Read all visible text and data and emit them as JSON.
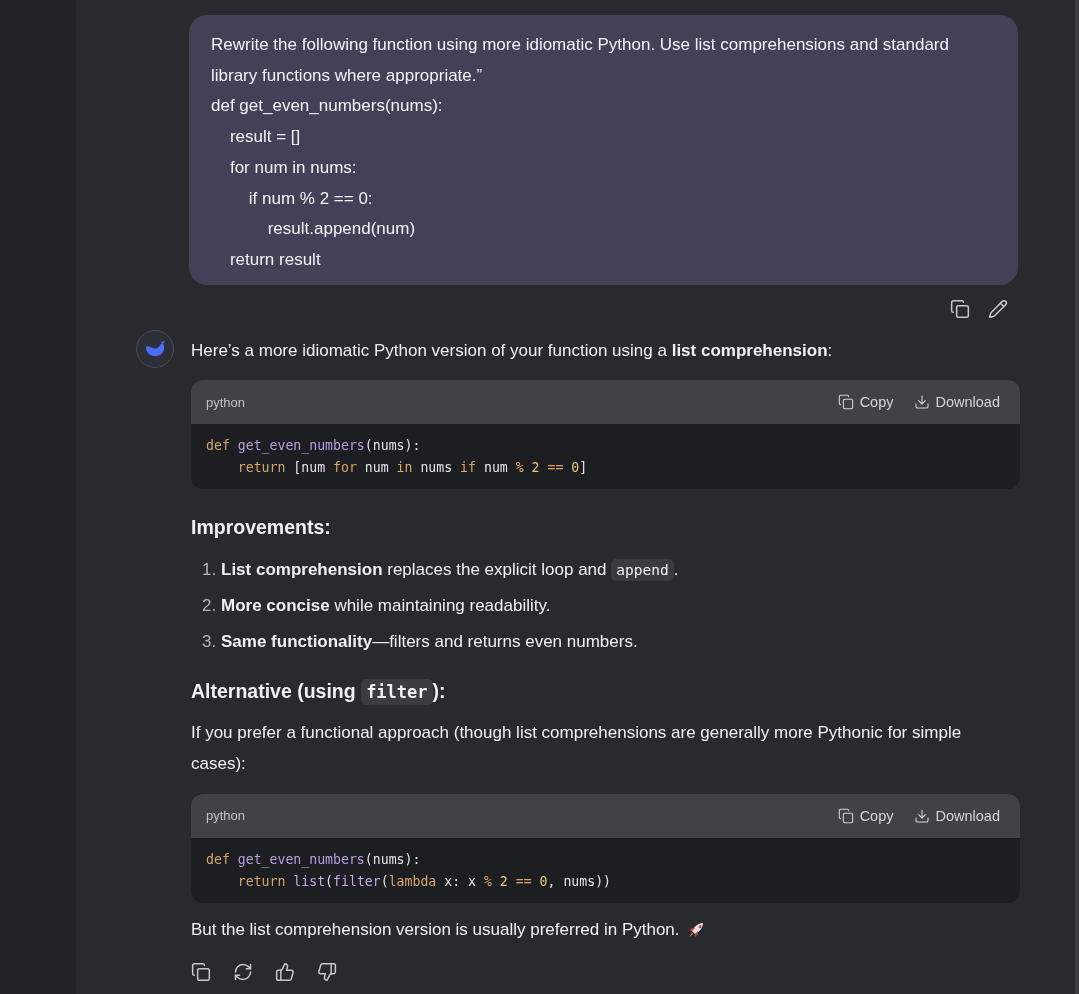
{
  "user_message": {
    "lines": [
      "Rewrite the following function using more idiomatic Python. Use list comprehensions and standard library functions where appropriate.”",
      "def get_even_numbers(nums):",
      "    result = []",
      "    for num in nums:",
      "        if num % 2 == 0:",
      "            result.append(num)",
      "    return result"
    ]
  },
  "answer": {
    "intro": "Here’s a more idiomatic Python version of your function using a **list comprehension**:",
    "blocks": [
      {
        "kind": "code",
        "language": "python",
        "copy_label": "Copy",
        "download_label": "Download",
        "lines": [
          [
            {
              "text": "def ",
              "kind": "keyword"
            },
            {
              "text": "get_even_numbers",
              "kind": "function"
            },
            {
              "text": "(nums):",
              "kind": "plain"
            }
          ],
          [
            {
              "text": "    return",
              "kind": "keyword"
            },
            {
              "text": " [num ",
              "kind": "plain"
            },
            {
              "text": "for",
              "kind": "keyword"
            },
            {
              "text": " num ",
              "kind": "plain"
            },
            {
              "text": "in",
              "kind": "keyword"
            },
            {
              "text": " nums ",
              "kind": "plain"
            },
            {
              "text": "if",
              "kind": "keyword"
            },
            {
              "text": " num ",
              "kind": "plain"
            },
            {
              "text": "% ",
              "kind": "operator"
            },
            {
              "text": "2 ",
              "kind": "number"
            },
            {
              "text": "== ",
              "kind": "operator"
            },
            {
              "text": "0",
              "kind": "number"
            },
            {
              "text": "]",
              "kind": "plain"
            }
          ]
        ]
      },
      {
        "kind": "heading",
        "parts": [
          {
            "text": "Improvements:",
            "kind": "text"
          }
        ]
      },
      {
        "kind": "list",
        "items": [
          {
            "number": "1.",
            "parts": [
              {
                "text": "List comprehension",
                "kind": "bold"
              },
              {
                "text": " replaces the explicit loop and ",
                "kind": "text"
              },
              {
                "text": "append",
                "kind": "code"
              },
              {
                "text": ".",
                "kind": "text"
              }
            ]
          },
          {
            "number": "2.",
            "parts": [
              {
                "text": "More concise",
                "kind": "bold"
              },
              {
                "text": " while maintaining readability.",
                "kind": "text"
              }
            ]
          },
          {
            "number": "3.",
            "parts": [
              {
                "text": "Same functionality",
                "kind": "bold"
              },
              {
                "text": "—filters and returns even numbers.",
                "kind": "text"
              }
            ]
          }
        ]
      },
      {
        "kind": "heading",
        "parts": [
          {
            "text": "Alternative (using ",
            "kind": "text"
          },
          {
            "text": "filter",
            "kind": "code"
          },
          {
            "text": "):",
            "kind": "text"
          }
        ]
      },
      {
        "kind": "paragraph",
        "text": "If you prefer a functional approach (though list comprehensions are generally more Pythonic for simple cases):"
      },
      {
        "kind": "code",
        "language": "python",
        "copy_label": "Copy",
        "download_label": "Download",
        "lines": [
          [
            {
              "text": "def ",
              "kind": "keyword"
            },
            {
              "text": "get_even_numbers",
              "kind": "function"
            },
            {
              "text": "(nums):",
              "kind": "plain"
            }
          ],
          [
            {
              "text": "    return ",
              "kind": "keyword"
            },
            {
              "text": "list",
              "kind": "builtin"
            },
            {
              "text": "(",
              "kind": "plain"
            },
            {
              "text": "filter",
              "kind": "builtin"
            },
            {
              "text": "(",
              "kind": "plain"
            },
            {
              "text": "lambda",
              "kind": "keyword"
            },
            {
              "text": " x: x ",
              "kind": "plain"
            },
            {
              "text": "% ",
              "kind": "operator"
            },
            {
              "text": "2 ",
              "kind": "number"
            },
            {
              "text": "== ",
              "kind": "operator"
            },
            {
              "text": "0",
              "kind": "number"
            },
            {
              "text": ", nums))",
              "kind": "plain"
            }
          ]
        ]
      },
      {
        "kind": "closing",
        "text": "But the list comprehension version is usually preferred in Python."
      }
    ]
  }
}
